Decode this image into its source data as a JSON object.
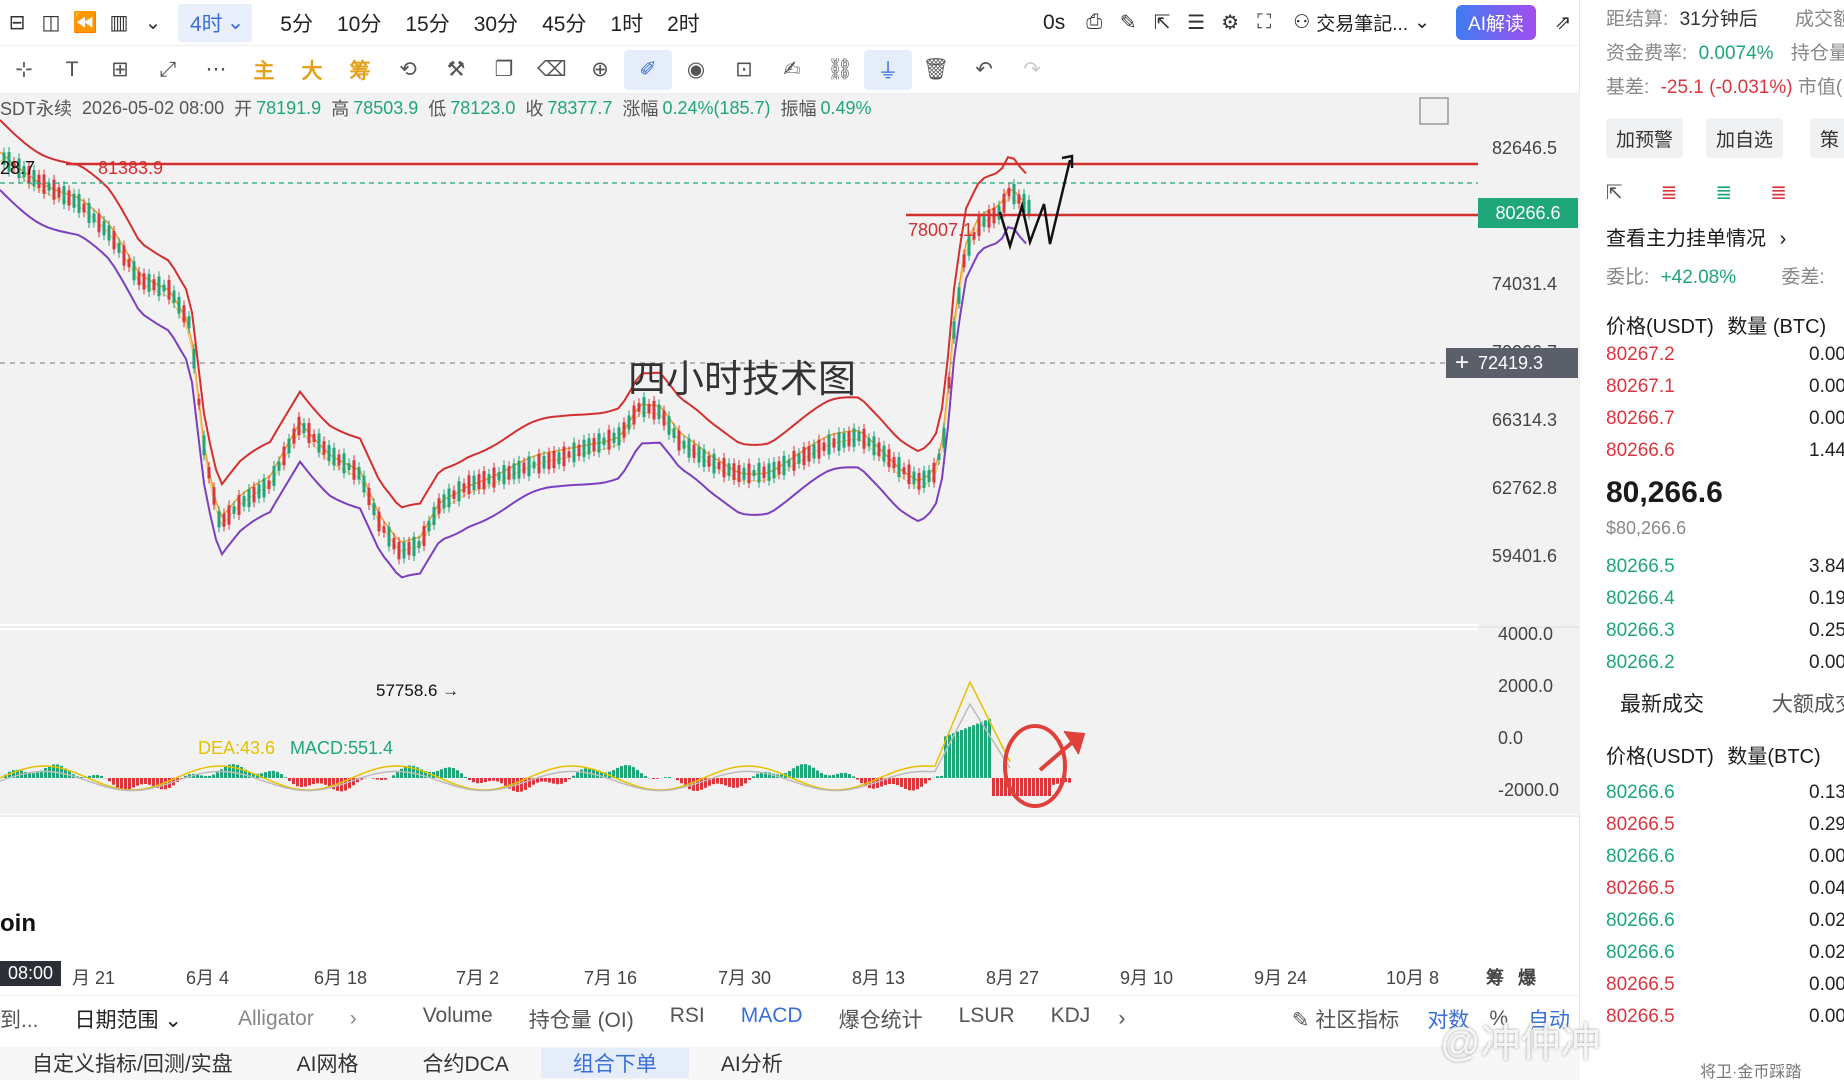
{
  "topbar": {
    "timeframes": [
      "4时",
      "5分",
      "10分",
      "15分",
      "30分",
      "45分",
      "1时",
      "2时"
    ],
    "active_timeframe": "4时",
    "countdown": "0s",
    "note_label": "交易筆記...",
    "ai_label": "AI解读"
  },
  "toolbar": {
    "text_tools": [
      "主",
      "大",
      "筹"
    ]
  },
  "info": {
    "symbol": "SDT永续",
    "datetime": "2026-05-02 08:00",
    "open_label": "开",
    "open": "78191.9",
    "high_label": "高",
    "high": "78503.9",
    "low_label": "低",
    "low": "78123.0",
    "close_label": "收",
    "close": "78377.7",
    "change_label": "涨幅",
    "change": "0.24%(185.7)",
    "amp_label": "振幅",
    "amp": "0.49%"
  },
  "annotations": {
    "title": "四小时技术图",
    "top_left_value": "28.7",
    "resistance_value": "81383.9",
    "support_value": "78007.1",
    "low_value": "57758.6 →",
    "coin": "oin"
  },
  "price_axis": [
    "82646.5",
    "78220.4",
    "74031.4",
    "70066.7",
    "66314.3",
    "62762.8",
    "59401.6"
  ],
  "current_price_tag": "80266.6",
  "crosshair_price_tag": "72419.3",
  "macd": {
    "dea_label": "DEA:43.6",
    "macd_label": "MACD:551.4",
    "axis": [
      "4000.0",
      "2000.0",
      "0.0",
      "-2000.0"
    ]
  },
  "date_axis": {
    "current": "08:00",
    "labels": [
      "月 21",
      "6月 4",
      "6月 18",
      "7月 2",
      "7月 16",
      "7月 30",
      "8月 13",
      "8月 27",
      "9月 10",
      "9月 24",
      "10月 8"
    ],
    "right_labels": [
      "筹",
      "爆"
    ]
  },
  "indicator_bar": {
    "first": "到...",
    "date_range": "日期范围",
    "alligator": "Alligator",
    "items": [
      "Volume",
      "持仓量 (OI)",
      "RSI",
      "MACD",
      "爆仓统计",
      "LSUR",
      "KDJ"
    ],
    "active": "MACD",
    "community": "社区指标",
    "log": "对数",
    "pct": "%",
    "auto": "自动"
  },
  "bottom_tabs": [
    "自定义指标/回测/实盘",
    "AI网格",
    "合约DCA",
    "组合下单",
    "AI分析"
  ],
  "bottom_active": "组合下单",
  "right": {
    "settle_label": "距结算:",
    "settle_value": "31分钟后",
    "volume_label": "成交额",
    "funding_label": "资金费率:",
    "funding_value": "0.0074%",
    "oi_label": "持仓量",
    "basis_label": "基差:",
    "basis_value": "-25.1 (-0.031%)",
    "mkt_label": "市值(",
    "btn_alert": "加预警",
    "btn_fav": "加自选",
    "btn_more": "策",
    "orderbook_title": "查看主力挂单情况",
    "ratio_label": "委比:",
    "ratio_value": "+42.08%",
    "ratio_diff": "委差:",
    "col_price": "价格(USDT)",
    "col_qty": "数量 (BTC)",
    "asks": [
      {
        "p": "80267.2",
        "q": "0.00"
      },
      {
        "p": "80267.1",
        "q": "0.00"
      },
      {
        "p": "80266.7",
        "q": "0.00"
      },
      {
        "p": "80266.6",
        "q": "1.44"
      }
    ],
    "last_price": "80,266.6",
    "last_price_usd": "$80,266.6",
    "bids": [
      {
        "p": "80266.5",
        "q": "3.84"
      },
      {
        "p": "80266.4",
        "q": "0.19"
      },
      {
        "p": "80266.3",
        "q": "0.25"
      },
      {
        "p": "80266.2",
        "q": "0.00"
      }
    ],
    "trades_tab": "最新成交",
    "large_tab": "大额成交",
    "trade_col_price": "价格(USDT)",
    "trade_col_qty": "数量(BTC)",
    "trades": [
      {
        "p": "80266.6",
        "q": "0.13",
        "side": "buy"
      },
      {
        "p": "80266.5",
        "q": "0.29",
        "side": "sell"
      },
      {
        "p": "80266.6",
        "q": "0.00",
        "side": "buy"
      },
      {
        "p": "80266.5",
        "q": "0.04",
        "side": "sell"
      },
      {
        "p": "80266.6",
        "q": "0.02",
        "side": "buy"
      },
      {
        "p": "80266.6",
        "q": "0.02",
        "side": "buy"
      },
      {
        "p": "80266.5",
        "q": "0.00",
        "side": "sell"
      },
      {
        "p": "80266.5",
        "q": "0.00",
        "side": "sell"
      }
    ],
    "watermark": "@冲仲冲",
    "watermark_sub": "将卫·金币踩踏"
  },
  "colors": {
    "up": "#1fa67a",
    "down": "#d9363e",
    "accent": "#3a6fd8",
    "upper_band": "#d32f2f",
    "lower_band": "#7b3fbf",
    "ma": "#f0a030"
  }
}
